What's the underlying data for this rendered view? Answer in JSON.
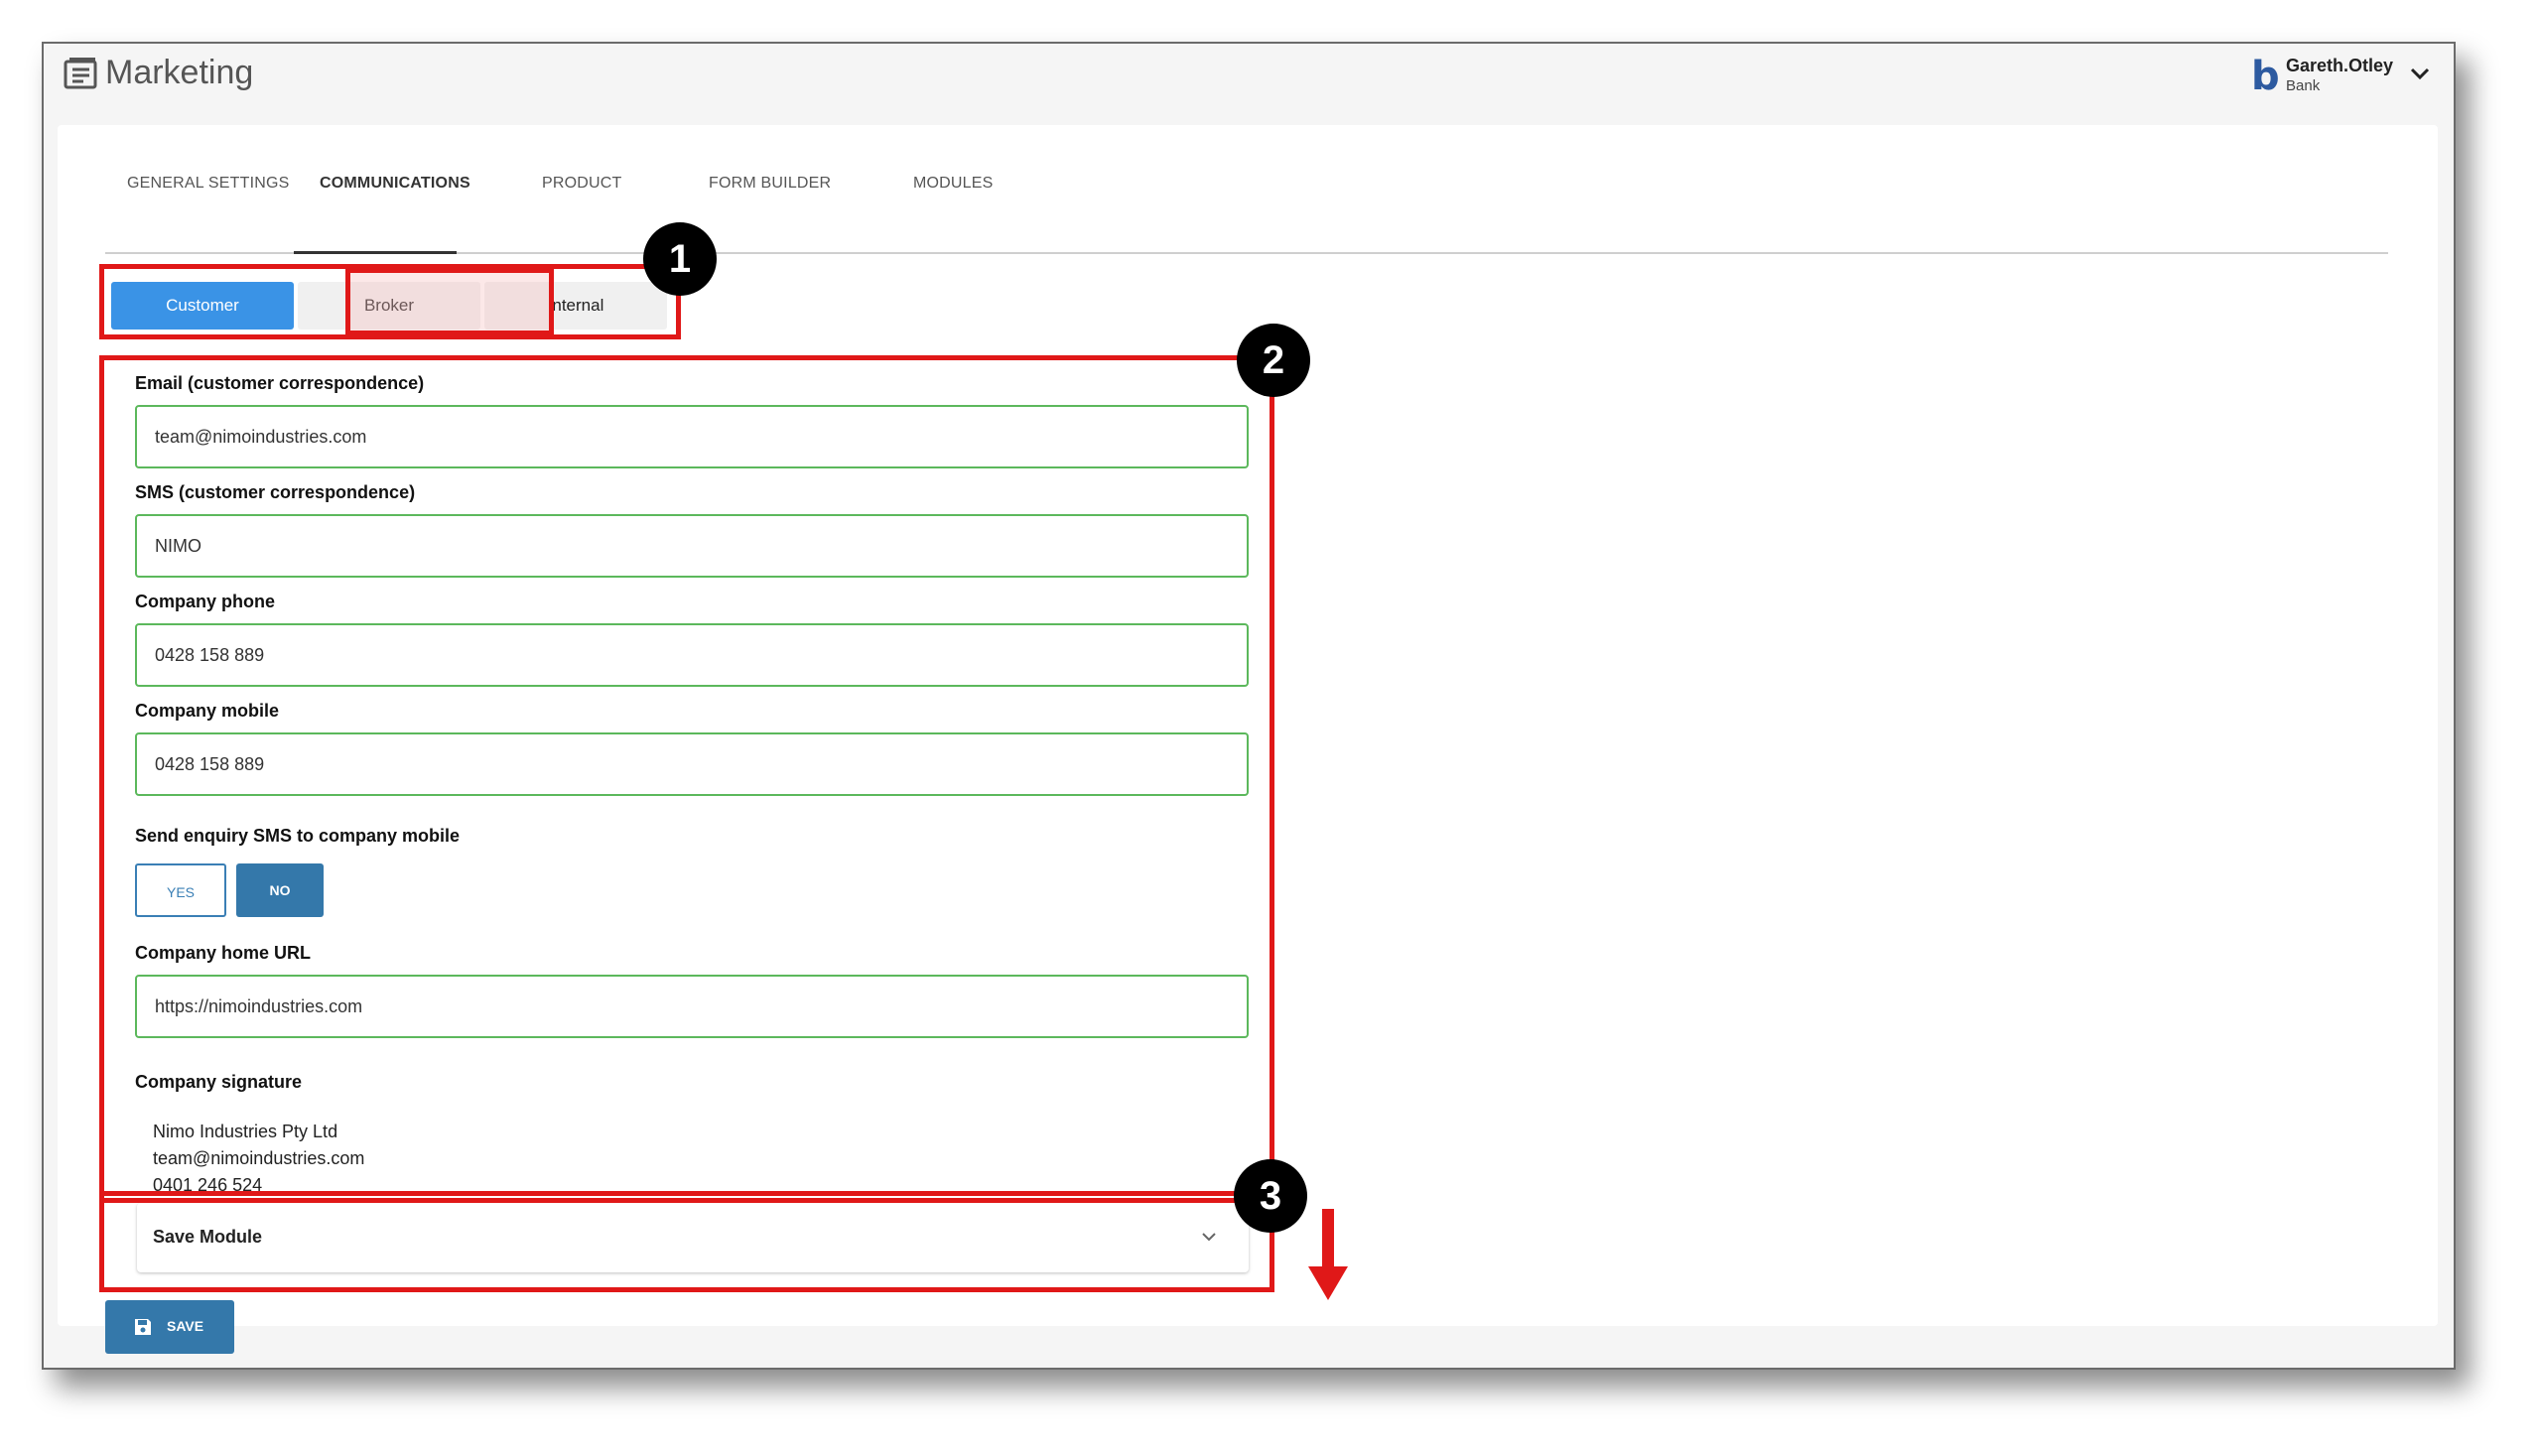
{
  "header": {
    "title": "Marketing",
    "brand_icon": "b",
    "user": {
      "name": "Gareth.Otley",
      "org": "Bank"
    }
  },
  "tabs": [
    {
      "label": "GENERAL SETTINGS"
    },
    {
      "label": "COMMUNICATIONS",
      "active": true
    },
    {
      "label": "PRODUCT"
    },
    {
      "label": "FORM BUILDER"
    },
    {
      "label": "MODULES"
    }
  ],
  "audience": {
    "options": [
      "Customer",
      "Broker",
      "Internal"
    ],
    "selected": "Customer"
  },
  "form": {
    "email_label": "Email (customer correspondence)",
    "email_value": "team@nimoindustries.com",
    "sms_label": "SMS (customer correspondence)",
    "sms_value": "NIMO",
    "phone_label": "Company phone",
    "phone_value": "0428 158 889",
    "mobile_label": "Company mobile",
    "mobile_value": "0428 158 889",
    "send_sms_label": "Send enquiry SMS to company mobile",
    "yes_label": "YES",
    "no_label": "NO",
    "send_sms_selected": "NO",
    "url_label": "Company home URL",
    "url_value": "https://nimoindustries.com",
    "signature_label": "Company signature",
    "signature_lines": [
      "Nimo Industries Pty Ltd",
      "team@nimoindustries.com",
      "0401 246 524"
    ]
  },
  "save_module": {
    "title": "Save Module"
  },
  "save_button": {
    "label": "SAVE"
  },
  "callouts": [
    "1",
    "2",
    "3"
  ],
  "colors": {
    "callout_red": "#e01818",
    "primary_blue": "#3a93e6",
    "button_blue": "#3478aa",
    "input_border_green": "#5cb85c"
  },
  "icons": [
    "logo-icon",
    "brand-icon",
    "chevron-down-icon",
    "save-icon",
    "down-arrow-icon"
  ]
}
